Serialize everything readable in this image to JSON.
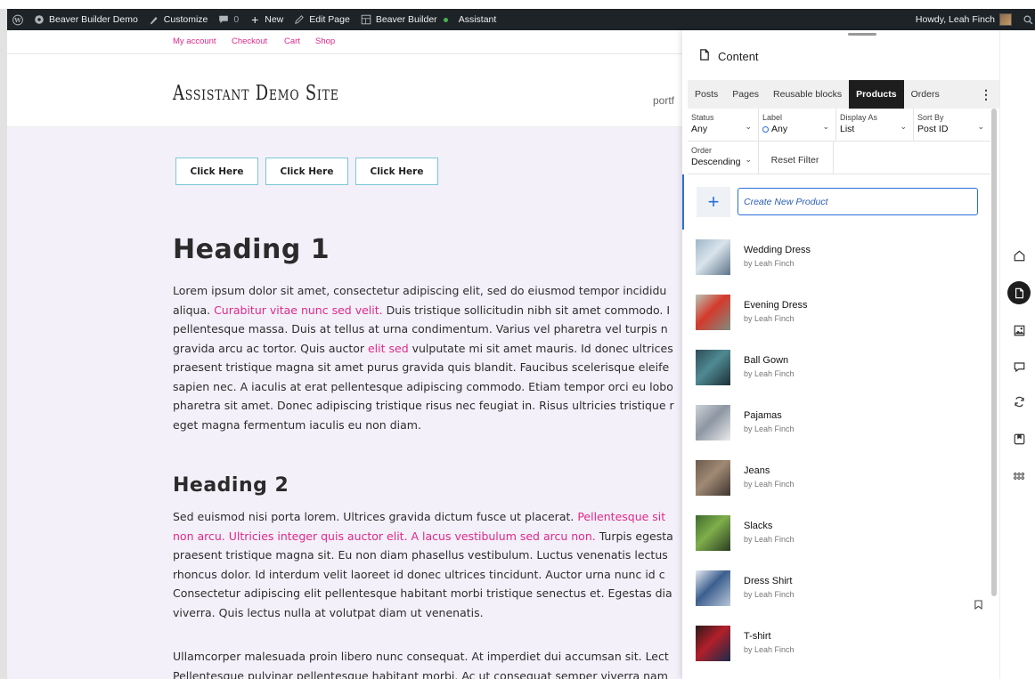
{
  "admin_bar": {
    "site_name": "Beaver Builder Demo",
    "customize": "Customize",
    "comments_count": "0",
    "new": "New",
    "edit_page": "Edit Page",
    "beaver_builder": "Beaver Builder",
    "assistant": "Assistant",
    "howdy": "Howdy, Leah Finch"
  },
  "site": {
    "nav": [
      "My account",
      "Checkout",
      "Cart",
      "Shop"
    ],
    "title": "Assistant Demo Site",
    "menu_partial": "portf",
    "buttons": [
      "Click Here",
      "Click Here",
      "Click Here"
    ],
    "heading1": "Heading 1",
    "para1": [
      {
        "t": "Lorem ipsum dolor sit amet, consectetur adipiscing elit, sed do eiusmod tempor incididu"
      },
      {
        "t": "aliqua. ",
        "link": "Curabitur vitae nunc sed velit.",
        "rest": " Duis tristique sollicitudin nibh sit amet commodo. I"
      },
      {
        "t": "pellentesque massa. Duis at tellus at urna condimentum. Varius vel pharetra vel turpis n"
      },
      {
        "t": "gravida arcu ac tortor. Quis auctor ",
        "link": "elit sed",
        "rest": " vulputate mi sit amet mauris. Id donec ultrices"
      },
      {
        "t": "praesent tristique magna sit amet purus gravida quis blandit. Faucibus scelerisque eleife"
      },
      {
        "t": "sapien nec. A iaculis at erat pellentesque adipiscing commodo. Etiam tempor orci eu lobo"
      },
      {
        "t": "pharetra sit amet. Donec adipiscing tristique risus nec feugiat in. Risus ultricies tristique r"
      },
      {
        "t": "eget magna fermentum iaculis eu non diam."
      }
    ],
    "heading2": "Heading 2",
    "para2": [
      {
        "t": "Sed euismod nisi porta lorem. Ultrices gravida dictum fusce ut placerat. ",
        "link": "Pellentesque sit"
      },
      {
        "t": "",
        "link": "non arcu. Ultricies integer quis auctor elit. A lacus vestibulum sed arcu non.",
        "rest": " Turpis egesta"
      },
      {
        "t": "praesent tristique magna sit. Eu non diam phasellus vestibulum. Luctus venenatis lectus"
      },
      {
        "t": "rhoncus dolor. Id interdum velit laoreet id donec ultrices tincidunt. Auctor urna nunc id c"
      },
      {
        "t": "Consectetur adipiscing elit pellentesque habitant morbi tristique senectus et. Egestas dia"
      },
      {
        "t": "viverra. Quis lectus nulla at volutpat diam ut venenatis."
      }
    ],
    "para3": [
      {
        "t": "Ullamcorper malesuada proin libero nunc consequat. At imperdiet dui accumsan sit. Lect"
      },
      {
        "t": "Pellentesque pulvinar pellentesque habitant morbi. Ac ut consequat semper viverra nam"
      }
    ]
  },
  "panel": {
    "title": "Content",
    "tabs": [
      "Posts",
      "Pages",
      "Reusable blocks",
      "Products",
      "Orders"
    ],
    "active_tab": "Products",
    "filters": {
      "status_label": "Status",
      "status_value": "Any",
      "label_label": "Label",
      "label_value": "Any",
      "display_label": "Display As",
      "display_value": "List",
      "sort_label": "Sort By",
      "sort_value": "Post ID",
      "order_label": "Order",
      "order_value": "Descending",
      "reset": "Reset Filter"
    },
    "create_placeholder": "Create New Product",
    "items": [
      {
        "title": "Wedding Dress",
        "author": "by Leah Finch",
        "thumb_colors": [
          "#9fb6c9",
          "#d9e4ec",
          "#5d7489"
        ]
      },
      {
        "title": "Evening Dress",
        "author": "by Leah Finch",
        "thumb_colors": [
          "#b9c6b8",
          "#d43a2b",
          "#7e8c80"
        ]
      },
      {
        "title": "Ball Gown",
        "author": "by Leah Finch",
        "thumb_colors": [
          "#2e4d57",
          "#4f8a93",
          "#1c2f36"
        ]
      },
      {
        "title": "Pajamas",
        "author": "by Leah Finch",
        "thumb_colors": [
          "#cfd3d8",
          "#8d96a3",
          "#e9eaec"
        ]
      },
      {
        "title": "Jeans",
        "author": "by Leah Finch",
        "thumb_colors": [
          "#6b5a4c",
          "#a08a74",
          "#3f3530"
        ]
      },
      {
        "title": "Slacks",
        "author": "by Leah Finch",
        "thumb_colors": [
          "#3f6b2f",
          "#7fae4a",
          "#2a3d22"
        ]
      },
      {
        "title": "Dress Shirt",
        "author": "by Leah Finch",
        "thumb_colors": [
          "#e7ecf2",
          "#3c5f8f",
          "#b8c6d6"
        ]
      },
      {
        "title": "T-shirt",
        "author": "by Leah Finch",
        "thumb_colors": [
          "#2b1a1a",
          "#b21f2a",
          "#1a2b4a"
        ]
      }
    ],
    "rail_icons": [
      "home-icon",
      "content-icon",
      "media-icon",
      "comments-icon",
      "updates-icon",
      "bookmarks-icon",
      "apps-icon"
    ]
  }
}
